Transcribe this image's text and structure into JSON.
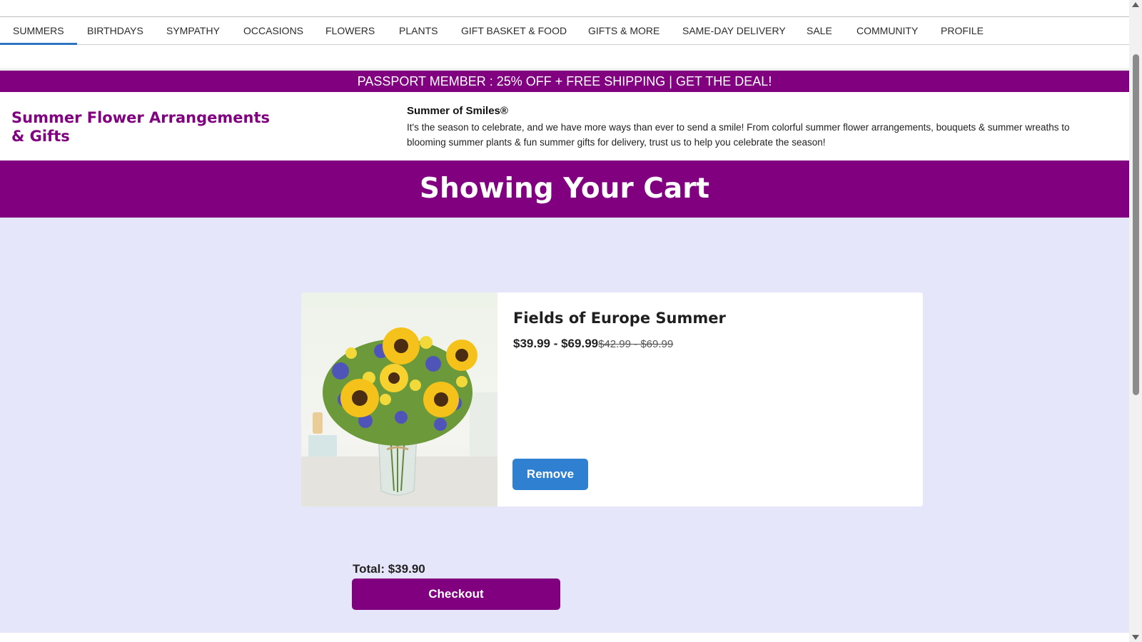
{
  "nav": {
    "items": [
      {
        "label": "SUMMERS",
        "active": true
      },
      {
        "label": "BIRTHDAYS"
      },
      {
        "label": "SYMPATHY"
      },
      {
        "label": "OCCASIONS"
      },
      {
        "label": "FLOWERS"
      },
      {
        "label": "PLANTS"
      },
      {
        "label": "GIFT BASKET & FOOD"
      },
      {
        "label": "GIFTS & MORE"
      },
      {
        "label": "SAME-DAY DELIVERY"
      },
      {
        "label": "SALE"
      },
      {
        "label": "COMMUNITY"
      },
      {
        "label": "PROFILE"
      }
    ]
  },
  "promo": {
    "text": "PASSPORT MEMBER : 25% OFF + FREE SHIPPING | GET THE DEAL!"
  },
  "intro": {
    "title": "Summer Flower Arrangements & Gifts",
    "heading": "Summer of Smiles®",
    "text": "It's the season to celebrate, and we have more ways than ever to send a smile! From colorful summer flower arrangements, bouquets & summer wreaths to blooming summer plants & fun summer gifts for delivery, trust us to help you celebrate the season!"
  },
  "banner": {
    "title": "Showing Your Cart"
  },
  "cart": {
    "item": {
      "name": "Fields of Europe Summer",
      "price": "$39.99 - $69.99",
      "original_price": "$42.99 - $69.99",
      "remove_label": "Remove"
    },
    "total_label": "Total: $39.90",
    "checkout_label": "Checkout"
  },
  "colors": {
    "brand_purple": "#800080",
    "cart_background": "#e6e6fa",
    "remove_button": "#2f80d0",
    "nav_active_underline": "#2f74c0"
  }
}
